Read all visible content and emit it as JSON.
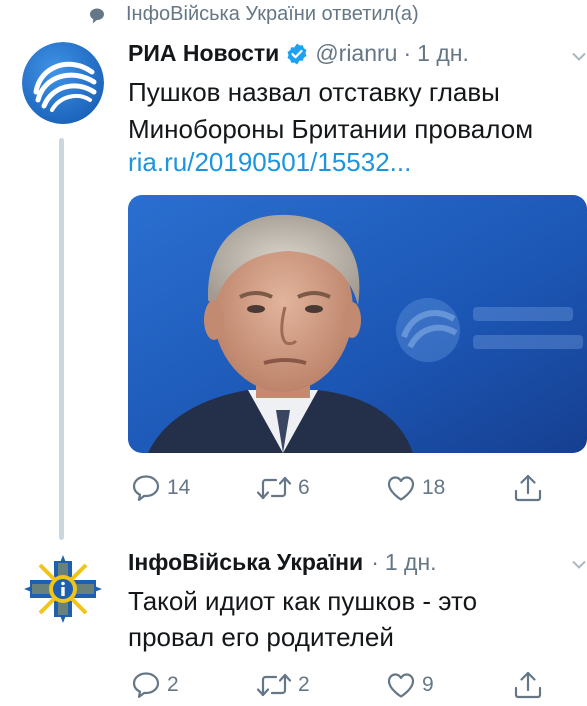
{
  "context": {
    "text": "ІнфоВійська України ответил(а)"
  },
  "tweet1": {
    "author_name": "РИА Новости",
    "handle": "@rianru",
    "separator": "·",
    "time": "1 дн.",
    "text_line1": "Пушков назвал отставку главы",
    "text_line2": "Минобороны Британии провалом",
    "link": "ria.ru/20190501/15532...",
    "media_watermark": "РИА НОВОСТИ",
    "actions": {
      "replies": "14",
      "retweets": "6",
      "likes": "18"
    }
  },
  "tweet2": {
    "author_name": "ІнфоВійська України",
    "separator": "·",
    "time": "1 дн.",
    "text_line1": "Такой идиот как пушков - это",
    "text_line2": "провал его родителей",
    "actions": {
      "replies": "2",
      "retweets": "2",
      "likes": "9"
    }
  },
  "colors": {
    "accent": "#1b95e0",
    "muted": "#657786",
    "verified": "#1da1f2",
    "ria_blue": "#1e73c8",
    "emblem_blue": "#1f5fb0",
    "emblem_gold": "#f0c419"
  }
}
